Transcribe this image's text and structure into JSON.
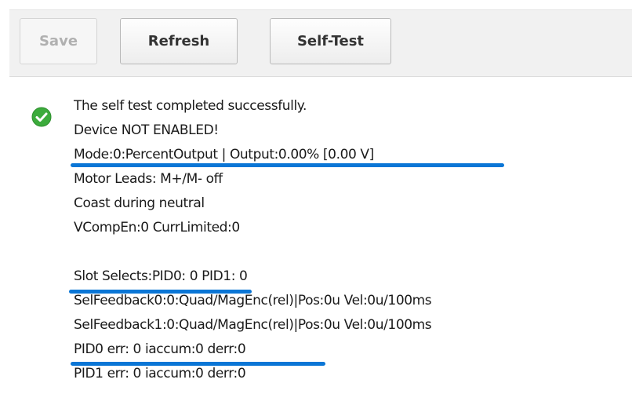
{
  "toolbar": {
    "save_label": "Save",
    "refresh_label": "Refresh",
    "selftest_label": "Self-Test"
  },
  "status": {
    "icon": "check-circle-icon",
    "color": "#3cab3c"
  },
  "report": {
    "lines": [
      "The self test completed successfully.",
      "Device NOT ENABLED!",
      "Mode:0:PercentOutput | Output:0.00% [0.00 V]",
      "Motor Leads: M+/M- off",
      "Coast during neutral",
      "VCompEn:0 CurrLimited:0",
      "",
      "Slot Selects:PID0: 0 PID1: 0",
      "SelFeedback0:0:Quad/MagEnc(rel)|Pos:0u  Vel:0u/100ms",
      "SelFeedback1:0:Quad/MagEnc(rel)|Pos:0u  Vel:0u/100ms",
      "PID0 err: 0 iaccum:0 derr:0",
      "PID1 err: 0 iaccum:0 derr:0"
    ]
  },
  "highlight_color": "#0a76d6"
}
